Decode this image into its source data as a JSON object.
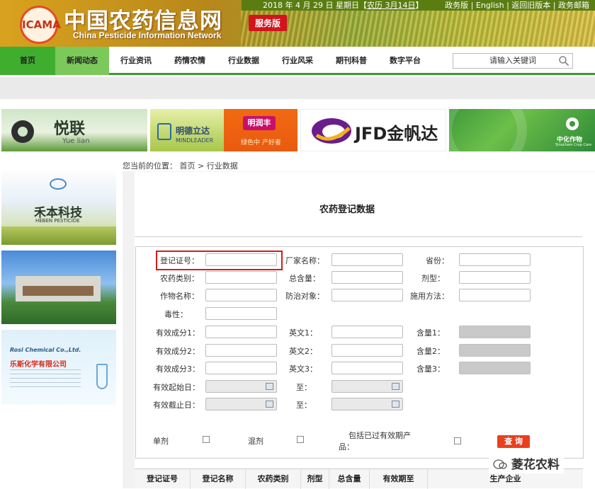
{
  "header": {
    "site_title": "中国农药信息网",
    "site_subtitle": "China Pesticide Information Network",
    "logo_text": "ICAMA",
    "service_badge": "服务版",
    "date": "2018 年 4 月 29 日 星期日【",
    "lunar": "农历 3月14日",
    "date_close": "】",
    "links": "政务版 | English | 返回旧版本 | 政务邮箱"
  },
  "nav": {
    "items": [
      "首页",
      "新闻动态",
      "行业资讯",
      "药情农情",
      "行业数据",
      "行业风采",
      "期刊科普",
      "数字平台"
    ],
    "search_placeholder": "请输入关键词"
  },
  "ads": {
    "yuelian": "悦联",
    "yuelian_en": "Yue lian",
    "mingde": "明德立达",
    "mingde_en": "MINDLEADER",
    "mingrunfeng": "明润丰",
    "mingrunfeng_sub": "绿色中 产好者",
    "jfd": "JFD金帆达",
    "sinochem": "中化作物",
    "sinochem_en": "Sinochem Crop Care"
  },
  "breadcrumb": "您当前的位置： 首页 > 行业数据",
  "sidebar": {
    "heben": "禾本科技",
    "heben_en": "HEBEN PESTICIDE",
    "rosi_en": "Rosi Chemical Co.,Ltd.",
    "rosi_cn": "乐斯化学有限公司"
  },
  "page_title": "农药登记数据",
  "form": {
    "reg_no": "登记证号：",
    "manufacturer": "厂家名称：",
    "province": "省份：",
    "category": "农药类别：",
    "total": "总含量：",
    "formulation": "剂型：",
    "crop": "作物名称：",
    "target": "防治对象：",
    "method": "施用方法：",
    "toxicity": "毒性：",
    "ing1": "有效成分1：",
    "en1": "英文1：",
    "c1": "含量1：",
    "ing2": "有效成分2：",
    "en2": "英文2：",
    "c2": "含量2：",
    "ing3": "有效成分3：",
    "en3": "英文3：",
    "c3": "含量3：",
    "start": "有效起始日：",
    "to1": "至：",
    "end": "有效截止日：",
    "to2": "至：",
    "single": "单剂",
    "mixed": "混剂",
    "include_expired_1": "包括已过有效期产",
    "include_expired_2": "品：",
    "query": "查 询"
  },
  "table": {
    "headers": [
      "登记证号",
      "登记名称",
      "农药类别",
      "剂型",
      "总含量",
      "有效期至",
      "生产企业"
    ]
  },
  "watermark": "菱花农料"
}
